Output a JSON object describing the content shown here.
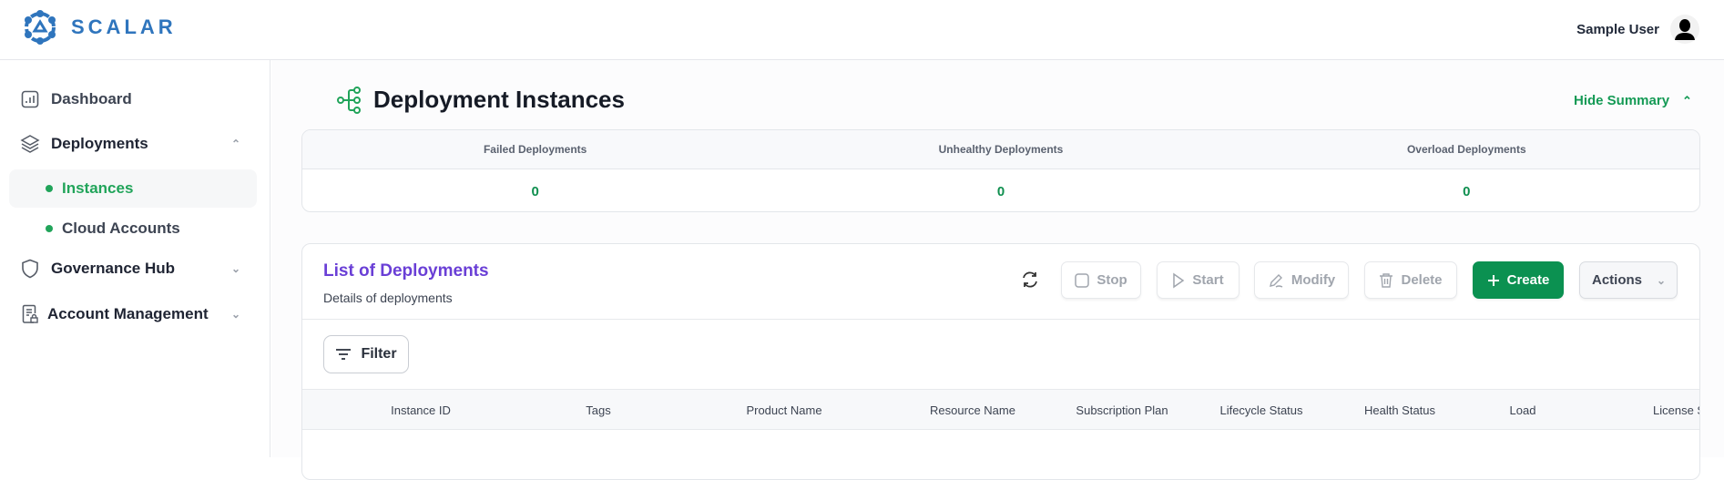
{
  "header": {
    "brand": "SCALAR",
    "user_name": "Sample User",
    "brand_color": "#2f75bd"
  },
  "sidebar": {
    "items": [
      {
        "label": "Dashboard",
        "icon": "bar-chart-icon"
      },
      {
        "label": "Deployments",
        "icon": "layers-icon",
        "expanded": true,
        "children": [
          {
            "label": "Instances",
            "active": true
          },
          {
            "label": "Cloud Accounts"
          }
        ]
      },
      {
        "label": "Governance Hub",
        "icon": "shield-icon",
        "expanded": false
      },
      {
        "label": "Account Management",
        "icon": "document-lock-icon",
        "expanded": false
      }
    ]
  },
  "main": {
    "title": "Deployment Instances",
    "hide_summary": "Hide Summary",
    "summary": [
      {
        "label": "Failed Deployments",
        "value": "0"
      },
      {
        "label": "Unhealthy Deployments",
        "value": "0"
      },
      {
        "label": "Overload Deployments",
        "value": "0"
      }
    ],
    "list": {
      "title": "List of Deployments",
      "subtitle": "Details of deployments",
      "buttons": {
        "stop": "Stop",
        "start": "Start",
        "modify": "Modify",
        "delete": "Delete",
        "create": "Create",
        "actions": "Actions"
      },
      "filter": "Filter",
      "columns": [
        "Instance ID",
        "Tags",
        "Product Name",
        "Resource Name",
        "Subscription Plan",
        "Lifecycle Status",
        "Health Status",
        "Load",
        "License Status"
      ]
    }
  },
  "colors": {
    "accent_green": "#0b9151",
    "title_purple": "#6a3fd6"
  }
}
